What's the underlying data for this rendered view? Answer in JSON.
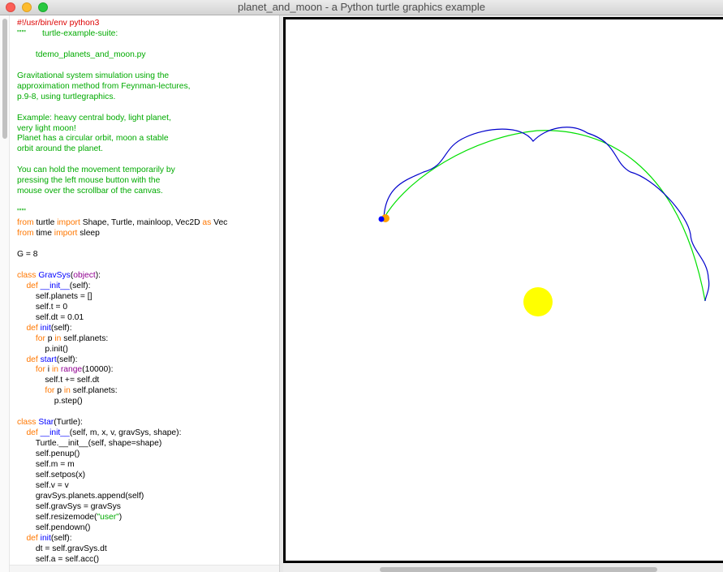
{
  "window": {
    "title": "planet_and_moon - a Python turtle graphics example"
  },
  "colors": {
    "code_default": "#000000",
    "code_comment": "#dd0000",
    "code_string": "#00aa00",
    "code_keyword": "#ff7700",
    "code_builtin": "#900090",
    "code_name": "#0000ff",
    "sun": "#ffff00",
    "planet_orbit": "#00e000",
    "moon_orbit": "#0000cc",
    "planet": "#0000ff",
    "moon": "#ffa000"
  },
  "code_lines": [
    [
      {
        "t": "#!/usr/bin/env python3",
        "c": "comment"
      }
    ],
    [
      {
        "t": "\"\"\"       turtle-example-suite:",
        "c": "string"
      }
    ],
    [],
    [
      {
        "t": "        tdemo_planets_and_moon.py",
        "c": "string"
      }
    ],
    [],
    [
      {
        "t": "Gravitational system simulation using the",
        "c": "string"
      }
    ],
    [
      {
        "t": "approximation method from Feynman-lectures,",
        "c": "string"
      }
    ],
    [
      {
        "t": "p.9-8, using turtlegraphics.",
        "c": "string"
      }
    ],
    [],
    [
      {
        "t": "Example: heavy central body, light planet,",
        "c": "string"
      }
    ],
    [
      {
        "t": "very light moon!",
        "c": "string"
      }
    ],
    [
      {
        "t": "Planet has a circular orbit, moon a stable",
        "c": "string"
      }
    ],
    [
      {
        "t": "orbit around the planet.",
        "c": "string"
      }
    ],
    [],
    [
      {
        "t": "You can hold the movement temporarily by",
        "c": "string"
      }
    ],
    [
      {
        "t": "pressing the left mouse button with the",
        "c": "string"
      }
    ],
    [
      {
        "t": "mouse over the scrollbar of the canvas.",
        "c": "string"
      }
    ],
    [],
    [
      {
        "t": "\"\"\"",
        "c": "string"
      }
    ],
    [
      {
        "t": "from",
        "c": "keyword"
      },
      {
        "t": " turtle ",
        "c": "default"
      },
      {
        "t": "import",
        "c": "keyword"
      },
      {
        "t": " Shape, Turtle, mainloop, Vec2D ",
        "c": "default"
      },
      {
        "t": "as",
        "c": "keyword"
      },
      {
        "t": " Vec",
        "c": "default"
      }
    ],
    [
      {
        "t": "from",
        "c": "keyword"
      },
      {
        "t": " time ",
        "c": "default"
      },
      {
        "t": "import",
        "c": "keyword"
      },
      {
        "t": " sleep",
        "c": "default"
      }
    ],
    [],
    [
      {
        "t": "G = 8",
        "c": "default"
      }
    ],
    [],
    [
      {
        "t": "class",
        "c": "keyword"
      },
      {
        "t": " ",
        "c": "default"
      },
      {
        "t": "GravSys",
        "c": "name"
      },
      {
        "t": "(",
        "c": "default"
      },
      {
        "t": "object",
        "c": "builtin"
      },
      {
        "t": "):",
        "c": "default"
      }
    ],
    [
      {
        "t": "    ",
        "c": "default"
      },
      {
        "t": "def",
        "c": "keyword"
      },
      {
        "t": " ",
        "c": "default"
      },
      {
        "t": "__init__",
        "c": "name"
      },
      {
        "t": "(self):",
        "c": "default"
      }
    ],
    [
      {
        "t": "        self.planets = []",
        "c": "default"
      }
    ],
    [
      {
        "t": "        self.t = 0",
        "c": "default"
      }
    ],
    [
      {
        "t": "        self.dt = 0.01",
        "c": "default"
      }
    ],
    [
      {
        "t": "    ",
        "c": "default"
      },
      {
        "t": "def",
        "c": "keyword"
      },
      {
        "t": " ",
        "c": "default"
      },
      {
        "t": "init",
        "c": "name"
      },
      {
        "t": "(self):",
        "c": "default"
      }
    ],
    [
      {
        "t": "        ",
        "c": "default"
      },
      {
        "t": "for",
        "c": "keyword"
      },
      {
        "t": " p ",
        "c": "default"
      },
      {
        "t": "in",
        "c": "keyword"
      },
      {
        "t": " self.planets:",
        "c": "default"
      }
    ],
    [
      {
        "t": "            p.init()",
        "c": "default"
      }
    ],
    [
      {
        "t": "    ",
        "c": "default"
      },
      {
        "t": "def",
        "c": "keyword"
      },
      {
        "t": " ",
        "c": "default"
      },
      {
        "t": "start",
        "c": "name"
      },
      {
        "t": "(self):",
        "c": "default"
      }
    ],
    [
      {
        "t": "        ",
        "c": "default"
      },
      {
        "t": "for",
        "c": "keyword"
      },
      {
        "t": " i ",
        "c": "default"
      },
      {
        "t": "in",
        "c": "keyword"
      },
      {
        "t": " ",
        "c": "default"
      },
      {
        "t": "range",
        "c": "builtin"
      },
      {
        "t": "(10000):",
        "c": "default"
      }
    ],
    [
      {
        "t": "            self.t += self.dt",
        "c": "default"
      }
    ],
    [
      {
        "t": "            ",
        "c": "default"
      },
      {
        "t": "for",
        "c": "keyword"
      },
      {
        "t": " p ",
        "c": "default"
      },
      {
        "t": "in",
        "c": "keyword"
      },
      {
        "t": " self.planets:",
        "c": "default"
      }
    ],
    [
      {
        "t": "                p.step()",
        "c": "default"
      }
    ],
    [],
    [
      {
        "t": "class",
        "c": "keyword"
      },
      {
        "t": " ",
        "c": "default"
      },
      {
        "t": "Star",
        "c": "name"
      },
      {
        "t": "(Turtle):",
        "c": "default"
      }
    ],
    [
      {
        "t": "    ",
        "c": "default"
      },
      {
        "t": "def",
        "c": "keyword"
      },
      {
        "t": " ",
        "c": "default"
      },
      {
        "t": "__init__",
        "c": "name"
      },
      {
        "t": "(self, m, x, v, gravSys, shape):",
        "c": "default"
      }
    ],
    [
      {
        "t": "        Turtle.__init__(self, shape=shape)",
        "c": "default"
      }
    ],
    [
      {
        "t": "        self.penup()",
        "c": "default"
      }
    ],
    [
      {
        "t": "        self.m = m",
        "c": "default"
      }
    ],
    [
      {
        "t": "        self.setpos(x)",
        "c": "default"
      }
    ],
    [
      {
        "t": "        self.v = v",
        "c": "default"
      }
    ],
    [
      {
        "t": "        gravSys.planets.append(self)",
        "c": "default"
      }
    ],
    [
      {
        "t": "        self.gravSys = gravSys",
        "c": "default"
      }
    ],
    [
      {
        "t": "        self.resizemode(",
        "c": "default"
      },
      {
        "t": "\"user\"",
        "c": "string"
      },
      {
        "t": ")",
        "c": "default"
      }
    ],
    [
      {
        "t": "        self.pendown()",
        "c": "default"
      }
    ],
    [
      {
        "t": "    ",
        "c": "default"
      },
      {
        "t": "def",
        "c": "keyword"
      },
      {
        "t": " ",
        "c": "default"
      },
      {
        "t": "init",
        "c": "name"
      },
      {
        "t": "(self):",
        "c": "default"
      }
    ],
    [
      {
        "t": "        dt = self.gravSys.dt",
        "c": "default"
      }
    ],
    [
      {
        "t": "        self.a = self.acc()",
        "c": "default"
      }
    ]
  ]
}
